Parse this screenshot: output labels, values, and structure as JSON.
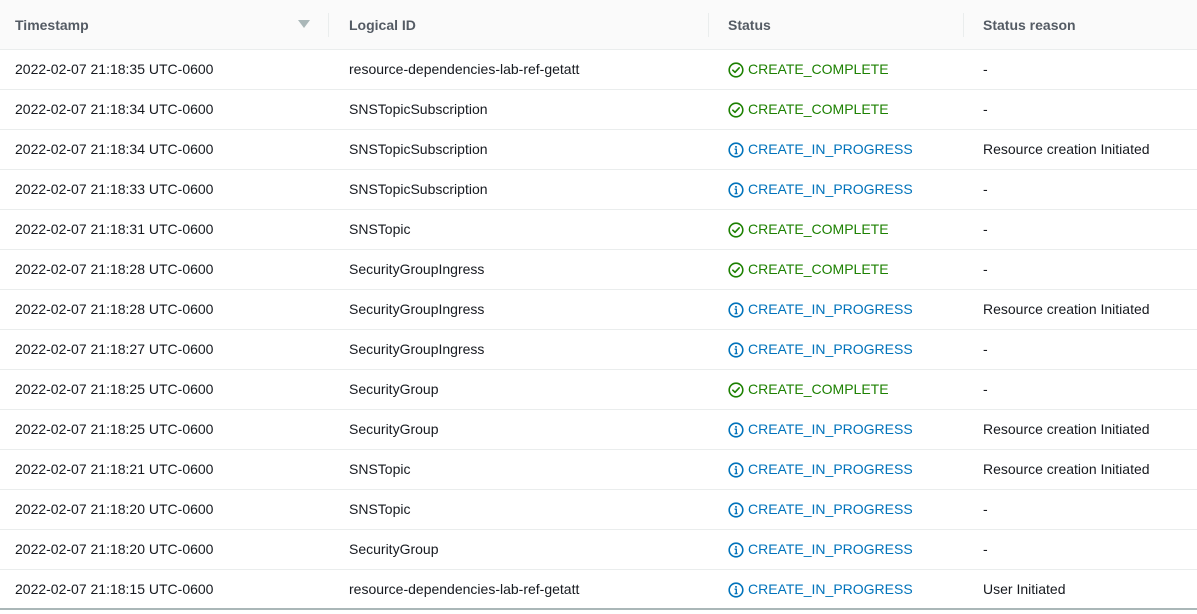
{
  "table": {
    "headers": [
      "Timestamp",
      "Logical ID",
      "Status",
      "Status reason"
    ],
    "rows": [
      {
        "timestamp": "2022-02-07 21:18:35 UTC-0600",
        "logical_id": "resource-dependencies-lab-ref-getatt",
        "status": "CREATE_COMPLETE",
        "icon": "check-circle-icon",
        "reason": "-"
      },
      {
        "timestamp": "2022-02-07 21:18:34 UTC-0600",
        "logical_id": "SNSTopicSubscription",
        "status": "CREATE_COMPLETE",
        "icon": "check-circle-icon",
        "reason": "-"
      },
      {
        "timestamp": "2022-02-07 21:18:34 UTC-0600",
        "logical_id": "SNSTopicSubscription",
        "status": "CREATE_IN_PROGRESS",
        "icon": "info-circle-icon",
        "reason": "Resource creation Initiated"
      },
      {
        "timestamp": "2022-02-07 21:18:33 UTC-0600",
        "logical_id": "SNSTopicSubscription",
        "status": "CREATE_IN_PROGRESS",
        "icon": "info-circle-icon",
        "reason": "-"
      },
      {
        "timestamp": "2022-02-07 21:18:31 UTC-0600",
        "logical_id": "SNSTopic",
        "status": "CREATE_COMPLETE",
        "icon": "check-circle-icon",
        "reason": "-"
      },
      {
        "timestamp": "2022-02-07 21:18:28 UTC-0600",
        "logical_id": "SecurityGroupIngress",
        "status": "CREATE_COMPLETE",
        "icon": "check-circle-icon",
        "reason": "-"
      },
      {
        "timestamp": "2022-02-07 21:18:28 UTC-0600",
        "logical_id": "SecurityGroupIngress",
        "status": "CREATE_IN_PROGRESS",
        "icon": "info-circle-icon",
        "reason": "Resource creation Initiated"
      },
      {
        "timestamp": "2022-02-07 21:18:27 UTC-0600",
        "logical_id": "SecurityGroupIngress",
        "status": "CREATE_IN_PROGRESS",
        "icon": "info-circle-icon",
        "reason": "-"
      },
      {
        "timestamp": "2022-02-07 21:18:25 UTC-0600",
        "logical_id": "SecurityGroup",
        "status": "CREATE_COMPLETE",
        "icon": "check-circle-icon",
        "reason": "-"
      },
      {
        "timestamp": "2022-02-07 21:18:25 UTC-0600",
        "logical_id": "SecurityGroup",
        "status": "CREATE_IN_PROGRESS",
        "icon": "info-circle-icon",
        "reason": "Resource creation Initiated"
      },
      {
        "timestamp": "2022-02-07 21:18:21 UTC-0600",
        "logical_id": "SNSTopic",
        "status": "CREATE_IN_PROGRESS",
        "icon": "info-circle-icon",
        "reason": "Resource creation Initiated"
      },
      {
        "timestamp": "2022-02-07 21:18:20 UTC-0600",
        "logical_id": "SNSTopic",
        "status": "CREATE_IN_PROGRESS",
        "icon": "info-circle-icon",
        "reason": "-"
      },
      {
        "timestamp": "2022-02-07 21:18:20 UTC-0600",
        "logical_id": "SecurityGroup",
        "status": "CREATE_IN_PROGRESS",
        "icon": "info-circle-icon",
        "reason": "-"
      },
      {
        "timestamp": "2022-02-07 21:18:15 UTC-0600",
        "logical_id": "resource-dependencies-lab-ref-getatt",
        "status": "CREATE_IN_PROGRESS",
        "icon": "info-circle-icon",
        "reason": "User Initiated"
      }
    ]
  },
  "sort_icon": "sort-descending-icon",
  "colors": {
    "complete": "#1d8102",
    "in_progress": "#0073bb",
    "header_bg": "#fafafa",
    "border": "#eaeded"
  }
}
